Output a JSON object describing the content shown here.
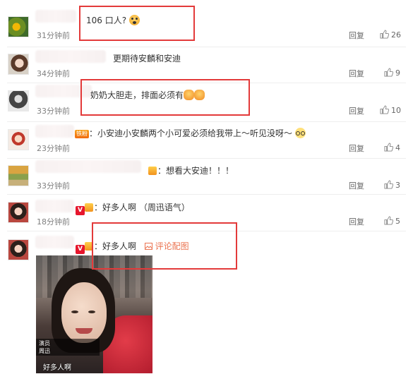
{
  "comments": [
    {
      "text": "106 口人?",
      "time": "31分钟前",
      "reply": "回复",
      "likes": "26",
      "avatar_icon": "sunflower-avatar-icon",
      "emoji": "scream-emoji"
    },
    {
      "text": "更期待安麟和安迪",
      "time": "34分钟前",
      "reply": "回复",
      "likes": "9",
      "avatar_icon": "girl-avatar-icon"
    },
    {
      "text": "奶奶大胆走，排面必须有",
      "time": "33分钟前",
      "reply": "回复",
      "likes": "10",
      "avatar_icon": "bw-avatar-icon",
      "emoji": "face-emoji"
    },
    {
      "badge": "铁粉",
      "text": "：小安迪小安麟两个小可爱必须给我带上～听见没呀～",
      "time": "23分钟前",
      "reply": "回复",
      "likes": "4",
      "avatar_icon": "cartoon-avatar-icon",
      "emoji": "glasses-emoji"
    },
    {
      "text": "：想看大安迪！！！",
      "time": "33分钟前",
      "reply": "回复",
      "likes": "3",
      "avatar_icon": "autumn-avatar-icon"
    },
    {
      "text": "：好多人啊 （周迅语气）",
      "time": "18分钟前",
      "reply": "回复",
      "likes": "5",
      "avatar_icon": "woman-avatar-icon"
    },
    {
      "text": "：好多人啊",
      "pic_label": "评论配图",
      "avatar_icon": "woman-avatar-icon"
    }
  ],
  "image_caption": {
    "line1": "演员",
    "line2": "周迅",
    "bottom": "好多人啊"
  },
  "colors": {
    "red_box": "#e33a3a",
    "link": "#eb7350",
    "muted": "#808080"
  }
}
